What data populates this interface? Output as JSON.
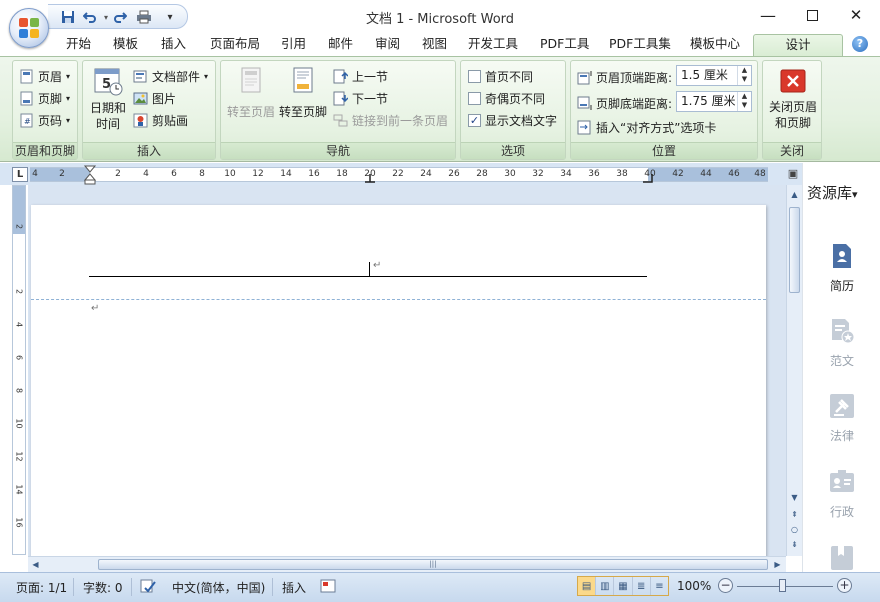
{
  "window": {
    "title": "文档 1 - Microsoft Word",
    "minimize_symbol": "—",
    "maximize_symbol": "☐",
    "close_symbol": "✕"
  },
  "quick_access": {
    "save_icon": "save-icon",
    "undo_icon": "undo-icon",
    "redo_icon": "redo-icon",
    "print_icon": "print-icon",
    "customize_symbol": "▾"
  },
  "tabs": [
    "开始",
    "模板",
    "插入",
    "页面布局",
    "引用",
    "邮件",
    "审阅",
    "视图",
    "开发工具",
    "PDF工具",
    "PDF工具集",
    "模板中心"
  ],
  "active_tab": "设计",
  "ribbon": {
    "group1": {
      "label": "页眉和页脚",
      "header": "页眉",
      "footer": "页脚",
      "page_number": "页码"
    },
    "group2": {
      "label": "插入",
      "date_time": "日期和时间",
      "date_time_line1": "日期和",
      "date_time_line2": "时间",
      "date_icon_number": "5",
      "quick_parts": "文档部件",
      "picture": "图片",
      "clip_art": "剪贴画"
    },
    "group3": {
      "label": "导航",
      "goto_header": "转至页眉",
      "goto_footer": "转至页脚",
      "previous_section": "上一节",
      "next_section": "下一节",
      "link_to_previous": "链接到前一条页眉"
    },
    "group4": {
      "label": "选项",
      "different_first_page": "首页不同",
      "different_odd_even": "奇偶页不同",
      "show_document_text": "显示文档文字",
      "checked_mark": "✓"
    },
    "group5": {
      "label": "位置",
      "header_from_top_label": "页眉顶端距离:",
      "header_from_top_value": "1.5 厘米",
      "footer_from_bottom_label": "页脚底端距离:",
      "footer_from_bottom_value": "1.75 厘米",
      "insert_alignment_tab": "插入“对齐方式”选项卡"
    },
    "group6": {
      "label": "关闭",
      "close_line1": "关闭页眉",
      "close_line2": "和页脚"
    }
  },
  "ruler": {
    "corner": "L",
    "h_ticks": [
      "4",
      "2",
      "2",
      "4",
      "6",
      "8",
      "10",
      "12",
      "14",
      "16",
      "18",
      "20",
      "22",
      "24",
      "26",
      "28",
      "30",
      "32",
      "34",
      "36",
      "38",
      "40",
      "42",
      "44",
      "46",
      "48"
    ],
    "v_ticks": [
      "2",
      "2",
      "4",
      "6",
      "8",
      "10",
      "12",
      "14",
      "16"
    ]
  },
  "document": {
    "paragraph_mark": "↵"
  },
  "side_pane": {
    "title": "资源库",
    "dropdown_symbol": "▾",
    "items": [
      "简历",
      "范文",
      "法律",
      "行政"
    ]
  },
  "status": {
    "page": "页面: 1/1",
    "words": "字数: 0",
    "language": "中文(简体，中国)",
    "mode": "插入",
    "zoom": "100%",
    "zoom_out_symbol": "−",
    "zoom_in_symbol": "+",
    "zoom_level_percent": 100
  },
  "colors": {
    "ribbon_green": "#e4f1e0",
    "accent_blue": "#4a6fa5",
    "close_red": "#d9382b"
  }
}
